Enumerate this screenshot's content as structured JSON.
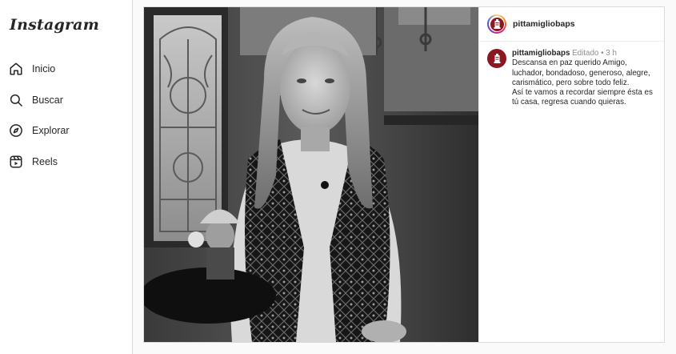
{
  "app": {
    "logo_text": "Instagram"
  },
  "sidebar": {
    "items": [
      {
        "label": "Inicio",
        "icon": "home-icon"
      },
      {
        "label": "Buscar",
        "icon": "search-icon"
      },
      {
        "label": "Explorar",
        "icon": "compass-icon"
      },
      {
        "label": "Reels",
        "icon": "reels-icon"
      }
    ]
  },
  "post": {
    "username": "pittamigliobaps",
    "caption": {
      "username": "pittamigliobaps",
      "edited": "Editado",
      "separator": "•",
      "time": "3 h",
      "text": "Descansa en paz querido Amigo, luchador, bondadoso, generoso, alegre, carismático, pero sobre todo feliz.\nAsí te vamos a recordar siempre ésta es tú casa, regresa cuando quieras."
    }
  },
  "colors": {
    "brand_avatar": "#8a1721",
    "border": "#dbdbdb",
    "muted_text": "#8e8e8e"
  }
}
